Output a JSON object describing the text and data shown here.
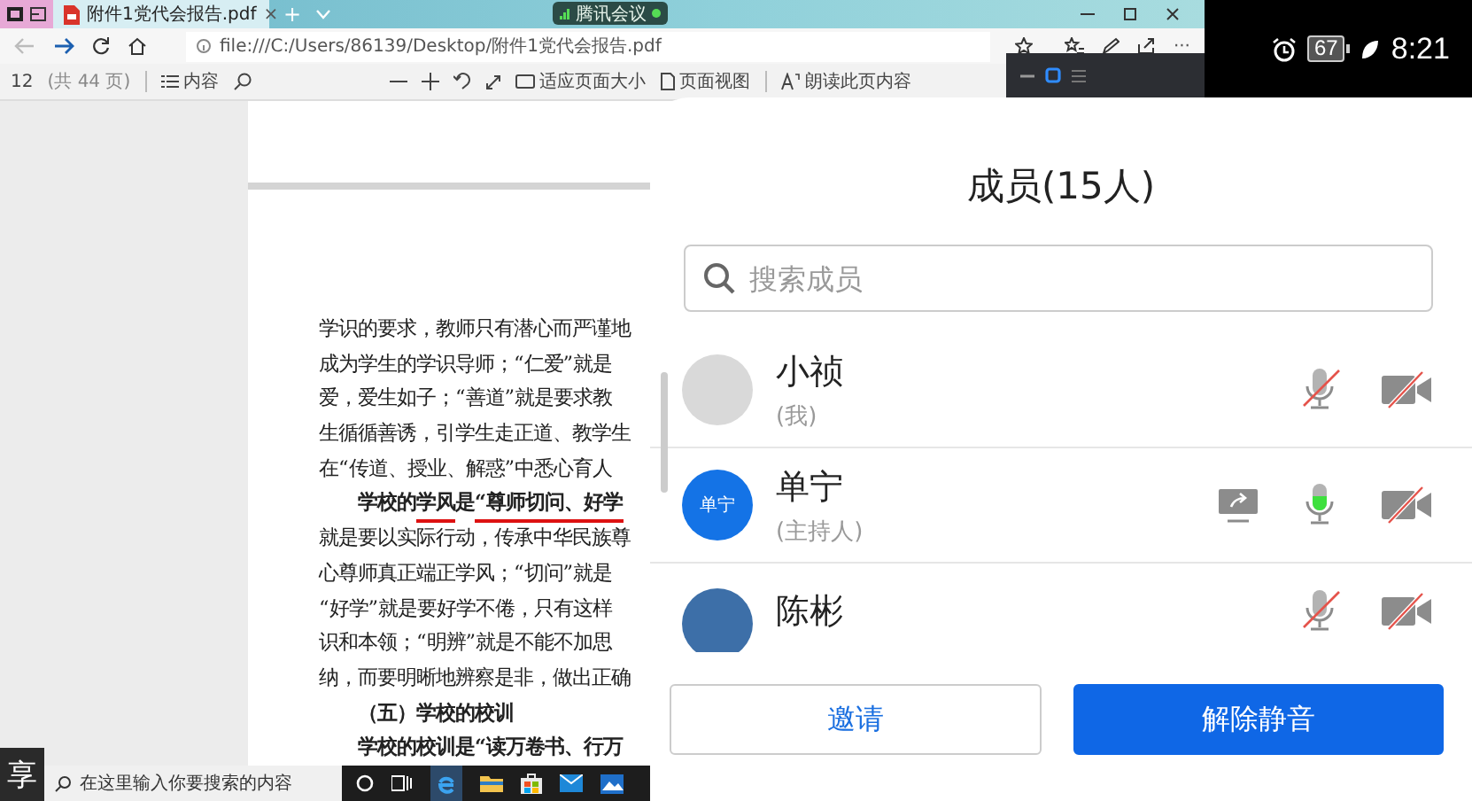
{
  "browser": {
    "tab_title": "附件1党代会报告.pdf",
    "tab_close": "×",
    "new_tab": "+",
    "address": "file:///C:/Users/86139/Desktop/附件1党代会报告.pdf",
    "more": "···"
  },
  "meeting_pill": {
    "label": "腾讯会议"
  },
  "pdf_toolbar": {
    "page": "12",
    "total": "(共 44 页)",
    "contents": "内容",
    "fit": "适应页面大小",
    "page_view": "页面视图",
    "read_aloud": "朗读此页内容"
  },
  "document": {
    "lines": [
      {
        "kind": "body",
        "segments": [
          {
            "text": "学识的要求，教师只有潜心而严谨地",
            "underlined": false
          }
        ]
      },
      {
        "kind": "body",
        "segments": [
          {
            "text": "成为学生的学识导师；“仁爱”就是",
            "underlined": false
          }
        ]
      },
      {
        "kind": "body",
        "segments": [
          {
            "text": "爱，爱生如子；“善道”就是要求教",
            "underlined": false
          }
        ]
      },
      {
        "kind": "body",
        "segments": [
          {
            "text": "生循循善诱，引学生走正道、教学生",
            "underlined": false
          }
        ]
      },
      {
        "kind": "body",
        "segments": [
          {
            "text": "在“传道、授业、解惑”中悉心育人",
            "underlined": false
          }
        ]
      },
      {
        "kind": "lead",
        "segments": [
          {
            "text": "学校的",
            "underlined": false
          },
          {
            "text": "学风",
            "underlined": true
          },
          {
            "text": "是 ",
            "underlined": false
          },
          {
            "text": "“尊师切问、好学",
            "underlined": true
          }
        ]
      },
      {
        "kind": "body",
        "segments": [
          {
            "text": "就是要以实际行动，传承中华民族尊",
            "underlined": false
          }
        ]
      },
      {
        "kind": "body",
        "segments": [
          {
            "text": "心尊师真正端正学风；“切问”就是",
            "underlined": false
          }
        ]
      },
      {
        "kind": "body",
        "segments": [
          {
            "text": "“好学”就是要好学不倦，只有这样",
            "underlined": false
          }
        ]
      },
      {
        "kind": "body",
        "segments": [
          {
            "text": "识和本领；“明辨”就是不能不加思",
            "underlined": false
          }
        ]
      },
      {
        "kind": "body",
        "segments": [
          {
            "text": "纳，而要明晰地辨察是非，做出正确",
            "underlined": false
          }
        ]
      },
      {
        "kind": "heading",
        "segments": [
          {
            "text": "（五）学校的校训",
            "underlined": false
          }
        ]
      },
      {
        "kind": "lead",
        "segments": [
          {
            "text": "学校的校训是“读万卷书、行万",
            "underlined": false
          }
        ]
      }
    ]
  },
  "share_label": "享",
  "taskbar": {
    "search_placeholder": "在这里输入你要搜索的内容"
  },
  "phone_status": {
    "battery": "67",
    "time": "8:21"
  },
  "members_panel": {
    "title": "成员(15人)",
    "search": {
      "placeholder": "搜索成员"
    },
    "members": [
      {
        "name": "小祯",
        "role": "(我)",
        "avatar": {
          "kind": "photo",
          "color": "#d9d9d9"
        },
        "sharing": false,
        "mic_muted": true,
        "camera_off": true
      },
      {
        "name": "单宁",
        "role": "(主持人)",
        "avatar": {
          "kind": "initials",
          "text": "单宁",
          "color": "#1473e6"
        },
        "sharing": true,
        "mic_muted": false,
        "camera_off": true
      },
      {
        "name": "陈彬",
        "avatar": {
          "kind": "photo",
          "color": "#3d6fa8"
        },
        "sharing": false,
        "mic_muted": true,
        "camera_off": true
      }
    ],
    "buttons": [
      {
        "label": "邀请",
        "kind": "secondary"
      },
      {
        "label": "解除静音",
        "kind": "primary"
      }
    ]
  }
}
